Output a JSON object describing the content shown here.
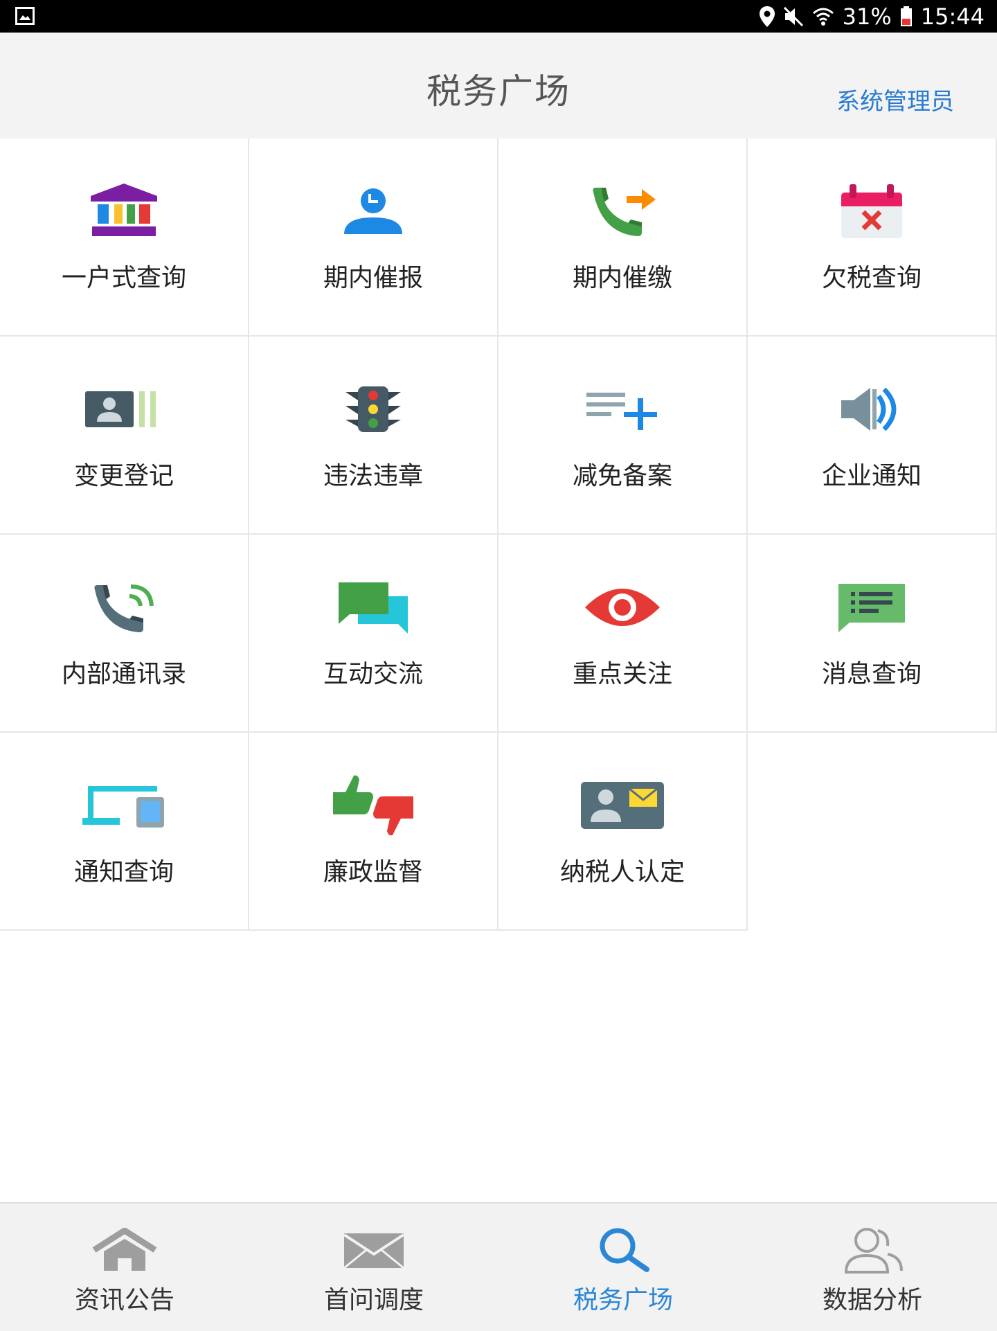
{
  "status_bar": {
    "battery": "31%",
    "time": "15:44"
  },
  "header": {
    "title": "税务广场",
    "admin_link": "系统管理员"
  },
  "grid": {
    "items": [
      {
        "label": "一户式查询",
        "icon": "bank-icon"
      },
      {
        "label": "期内催报",
        "icon": "user-clock-icon"
      },
      {
        "label": "期内催缴",
        "icon": "phone-forward-icon"
      },
      {
        "label": "欠税查询",
        "icon": "calendar-cancel-icon"
      },
      {
        "label": "变更登记",
        "icon": "id-card-icon"
      },
      {
        "label": "违法违章",
        "icon": "traffic-light-icon"
      },
      {
        "label": "减免备案",
        "icon": "playlist-add-icon"
      },
      {
        "label": "企业通知",
        "icon": "speaker-icon"
      },
      {
        "label": "内部通讯录",
        "icon": "phone-in-talk-icon"
      },
      {
        "label": "互动交流",
        "icon": "chat-bubbles-icon"
      },
      {
        "label": "重点关注",
        "icon": "eye-icon"
      },
      {
        "label": "消息查询",
        "icon": "message-list-icon"
      },
      {
        "label": "通知查询",
        "icon": "devices-icon"
      },
      {
        "label": "廉政监督",
        "icon": "thumbs-up-down-icon"
      },
      {
        "label": "纳税人认定",
        "icon": "contact-mail-icon"
      }
    ]
  },
  "bottom_nav": {
    "tabs": [
      {
        "label": "资讯公告",
        "icon": "home-icon",
        "active": false
      },
      {
        "label": "首问调度",
        "icon": "mail-icon",
        "active": false
      },
      {
        "label": "税务广场",
        "icon": "search-icon",
        "active": true
      },
      {
        "label": "数据分析",
        "icon": "users-icon",
        "active": false
      }
    ]
  },
  "colors": {
    "accent": "#2a86d6",
    "header_bg": "#f3f3f3",
    "bottom_bg": "#f2f2f2"
  }
}
